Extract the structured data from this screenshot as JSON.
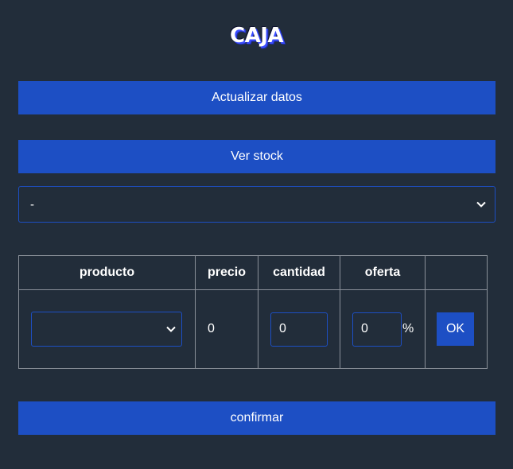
{
  "header": {
    "title": "CAJA"
  },
  "actions": {
    "update_label": "Actualizar datos",
    "stock_label": "Ver stock",
    "confirm_label": "confirmar"
  },
  "main_select": {
    "selected": "-"
  },
  "table": {
    "columns": [
      "producto",
      "precio",
      "cantidad",
      "oferta",
      ""
    ],
    "row": {
      "product_selected": "",
      "price": "0",
      "quantity": "0",
      "offer": "0",
      "offer_unit": "%",
      "ok_label": "OK"
    }
  },
  "colors": {
    "background": "#222d3a",
    "accent": "#1d4fc4",
    "border": "#8a9099"
  },
  "icons": {
    "select_chevron": "chevron-down-icon"
  }
}
